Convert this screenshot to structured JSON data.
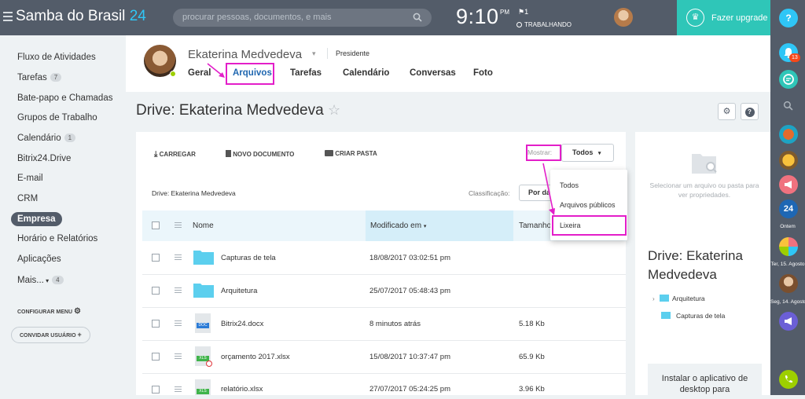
{
  "topbar": {
    "logo_main": "Samba do Brasil",
    "logo_num": "24",
    "search_placeholder": "procurar pessoas, documentos, e mais",
    "clock": "9:10",
    "clock_ampm": "PM",
    "flag_count": "1",
    "status": "TRABALHANDO",
    "upgrade_label": "Fazer upgrade"
  },
  "rightbar": {
    "help": "?",
    "notif_count": "13",
    "badge_24": "24",
    "caption_ontem": "Ontem",
    "caption_ter": "Ter, 15. Agosto",
    "caption_seg": "Seg, 14. Agosto"
  },
  "sidebar": {
    "items": [
      {
        "label": "Fluxo de Atividades"
      },
      {
        "label": "Tarefas",
        "count": "7"
      },
      {
        "label": "Bate-papo e Chamadas"
      },
      {
        "label": "Grupos de Trabalho"
      },
      {
        "label": "Calendário",
        "count": "1"
      },
      {
        "label": "Bitrix24.Drive"
      },
      {
        "label": "E-mail"
      },
      {
        "label": "CRM"
      },
      {
        "label": "Empresa"
      },
      {
        "label": "Horário e Relatórios"
      },
      {
        "label": "Aplicações"
      },
      {
        "label": "Mais...",
        "count": "4"
      }
    ],
    "configurar": "CONFIGURAR MENU",
    "convidar": "CONVIDAR USUÁRIO"
  },
  "profile": {
    "name": "Ekaterina Medvedeva",
    "position": "Presidente",
    "tabs": [
      "Geral",
      "Arquivos",
      "Tarefas",
      "Calendário",
      "Conversas",
      "Foto"
    ]
  },
  "drive": {
    "title": "Drive: Ekaterina Medvedeva",
    "toolbar": {
      "upload": "CARREGAR",
      "new_doc": "NOVO DOCUMENTO",
      "new_folder": "CRIAR PASTA"
    },
    "show_label": "Mostrar:",
    "filter_value": "Todos",
    "filter_options": [
      "Todos",
      "Arquivos públicos",
      "Lixeira"
    ],
    "breadcrumb": "Drive: Ekaterina Medvedeva",
    "sort_label": "Classificação:",
    "sort_value": "Por data",
    "columns": {
      "name": "Nome",
      "modified": "Modificado em",
      "size": "Tamanho"
    },
    "rows": [
      {
        "name": "Capturas de tela",
        "modified": "18/08/2017 03:02:51 pm",
        "size": "",
        "kind": "folder"
      },
      {
        "name": "Arquitetura",
        "modified": "25/07/2017 05:48:43 pm",
        "size": "",
        "kind": "folder"
      },
      {
        "name": "Bitrix24.docx",
        "modified": "8 minutos atrás",
        "size": "5.18 Kb",
        "kind": "docx",
        "badge": "DOC"
      },
      {
        "name": "orçamento 2017.xlsx",
        "modified": "15/08/2017 10:37:47 pm",
        "size": "65.9 Kb",
        "kind": "xlsx",
        "badge": "XLS"
      },
      {
        "name": "relatório.xlsx",
        "modified": "27/07/2017 05:24:25 pm",
        "size": "3.96 Kb",
        "kind": "xlsx",
        "badge": "XLS"
      }
    ]
  },
  "panel": {
    "hint": "Selecionar um arquivo ou pasta para ver propriedades.",
    "title": "Drive: Ekaterina Medvedeva",
    "tree": [
      "Arquitetura",
      "Capturas de tela"
    ],
    "install": "Instalar o aplicativo de desktop para"
  },
  "colors": {
    "topbar": "#535c69",
    "accent": "#2fc6f6",
    "upgrade": "#2fc6b8",
    "highlight": "#e31ec9"
  }
}
